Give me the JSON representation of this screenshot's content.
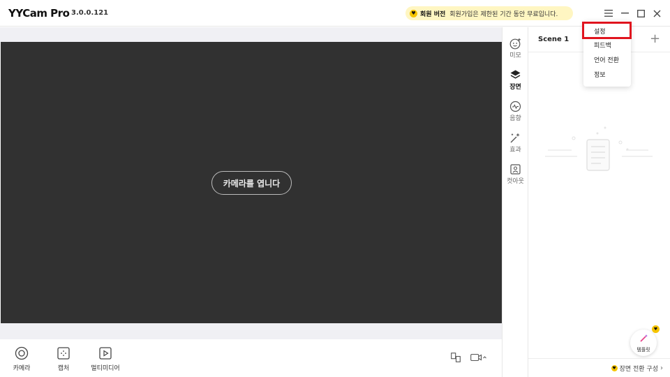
{
  "app": {
    "name": "YYCam Pro",
    "version": "3.0.0.121"
  },
  "member_banner": {
    "label": "회원 버전",
    "message": "회원가입은 제한된 기간 동안 무료입니다."
  },
  "window_controls": [
    "menu-icon",
    "minimize-icon",
    "maximize-icon",
    "close-icon"
  ],
  "camera": {
    "open_button": "카메라를 엽니다"
  },
  "bottom_tools": [
    {
      "label": "카메라",
      "icon": "camera-icon"
    },
    {
      "label": "캡처",
      "icon": "capture-icon"
    },
    {
      "label": "멀티미디어",
      "icon": "multimedia-icon"
    }
  ],
  "side_nav": [
    {
      "label": "미모",
      "icon": "face-icon"
    },
    {
      "label": "장면",
      "icon": "layers-icon",
      "active": true
    },
    {
      "label": "음향",
      "icon": "audio-icon"
    },
    {
      "label": "효과",
      "icon": "magic-wand-icon"
    },
    {
      "label": "컷아웃",
      "icon": "cutout-icon"
    }
  ],
  "scene_panel": {
    "title": "Scene 1",
    "template_label": "템플릿",
    "footer_label": "장면 전환 구성"
  },
  "dropdown_menu": {
    "items": [
      "설정",
      "피드백",
      "언어 전환",
      "정보"
    ],
    "highlighted_index": 0
  },
  "colors": {
    "accent_yellow": "#f5c400",
    "banner_bg": "#fff6c2",
    "camera_bg": "#313131",
    "highlight_red": "#e0141e"
  }
}
